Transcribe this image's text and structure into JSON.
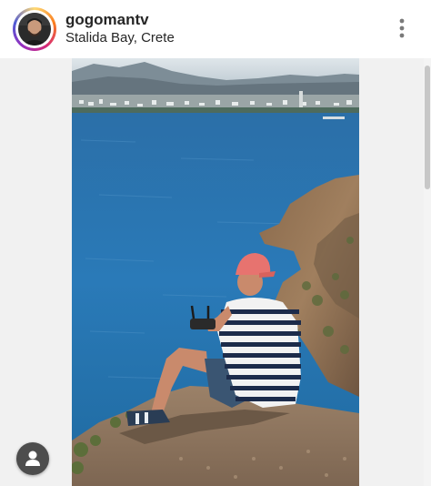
{
  "post": {
    "username": "gogomantv",
    "location": "Stalida Bay, Crete",
    "avatar_icon": "user-avatar",
    "more_icon": "more-vertical-icon"
  },
  "photo": {
    "description_icon": "photo"
  },
  "fab": {
    "icon": "person-icon"
  },
  "colors": {
    "text": "#262626",
    "photo_background": "#f1f1f1",
    "fab": "#4d4d4d",
    "ring_gradient": [
      "#feda75",
      "#fa7e1e",
      "#d62976",
      "#962fbf",
      "#4f5bd5"
    ]
  }
}
